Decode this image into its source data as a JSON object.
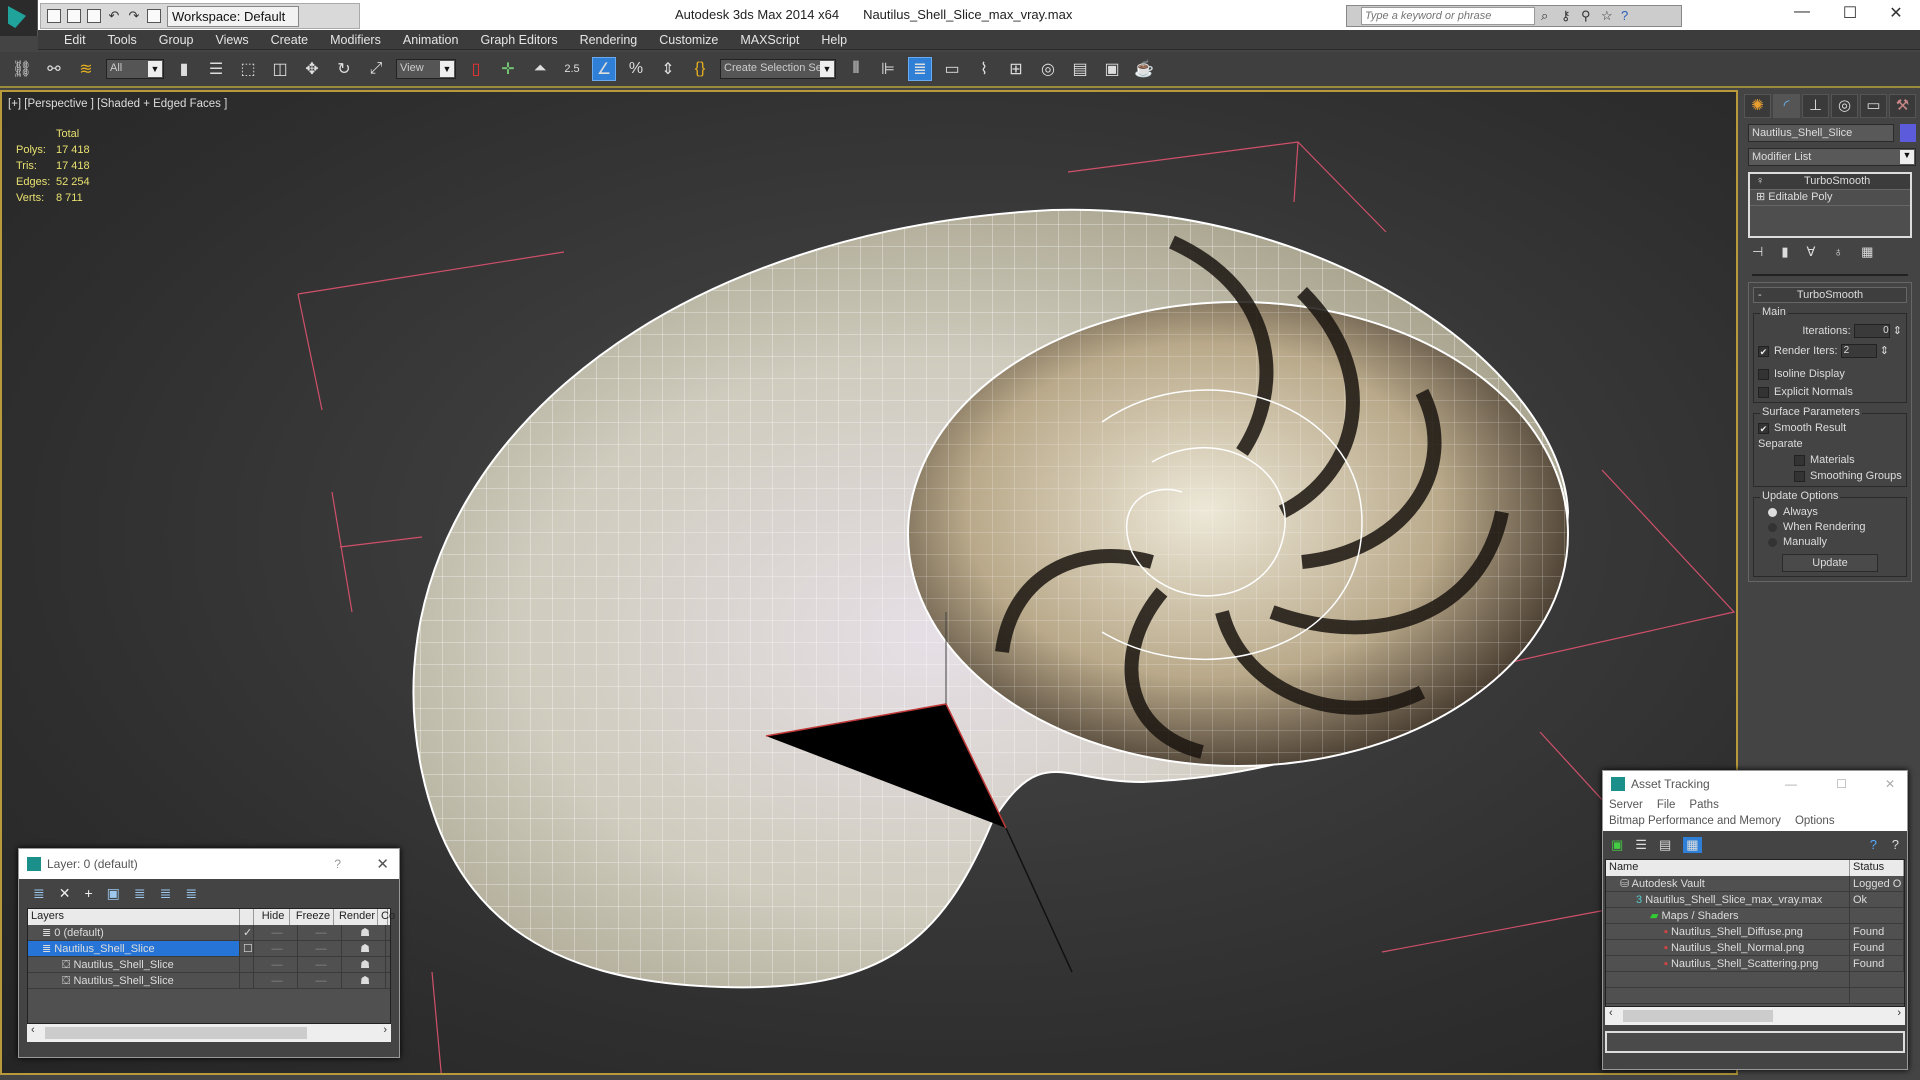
{
  "titlebar": {
    "app": "Autodesk 3ds Max 2014 x64",
    "file": "Nautilus_Shell_Slice_max_vray.max",
    "workspace": "Workspace: Default",
    "search_placeholder": "Type a keyword or phrase",
    "minimize": "—",
    "maximize": "☐",
    "close": "✕"
  },
  "menu": [
    "Edit",
    "Tools",
    "Group",
    "Views",
    "Create",
    "Modifiers",
    "Animation",
    "Graph Editors",
    "Rendering",
    "Customize",
    "MAXScript",
    "Help"
  ],
  "toolbar": {
    "selection_filter": "All",
    "coord_system": "View",
    "angle_snap_label": "2.5",
    "named_selection": "Create Selection Se"
  },
  "viewport": {
    "label": "[+] [Perspective ] [Shaded + Edged Faces ]",
    "stats": {
      "header": "Total",
      "rows": [
        {
          "k": "Polys:",
          "v": "17 418"
        },
        {
          "k": "Tris:",
          "v": "17 418"
        },
        {
          "k": "Edges:",
          "v": "52 254"
        },
        {
          "k": "Verts:",
          "v": "8 711"
        }
      ]
    }
  },
  "command_panel": {
    "object_name": "Nautilus_Shell_Slice",
    "object_color": "#5b5bdc",
    "modifier_list": "Modifier List",
    "stack": [
      "TurboSmooth",
      "Editable Poly"
    ],
    "rollout": {
      "title": "TurboSmooth",
      "main_label": "Main",
      "iterations_label": "Iterations:",
      "iterations": "0",
      "render_iters_label": "Render Iters:",
      "render_iters": "2",
      "render_iters_checked": true,
      "isoline": "Isoline Display",
      "explicit_normals": "Explicit Normals",
      "surface_label": "Surface Parameters",
      "smooth_result": "Smooth Result",
      "separate_label": "Separate",
      "materials": "Materials",
      "smoothing_groups": "Smoothing Groups",
      "update_label": "Update Options",
      "always": "Always",
      "when_rendering": "When Rendering",
      "manually": "Manually",
      "update_button": "Update"
    }
  },
  "layer_dialog": {
    "title": "Layer: 0 (default)",
    "help": "?",
    "close": "✕",
    "columns": [
      "Layers",
      "",
      "Hide",
      "Freeze",
      "Render",
      "Co"
    ],
    "rows": [
      {
        "name": "0 (default)",
        "current": "✓"
      },
      {
        "name": "Nautilus_Shell_Slice",
        "current": "☐"
      },
      {
        "name": "Nautilus_Shell_Slice",
        "current": ""
      },
      {
        "name": "Nautilus_Shell_Slice",
        "current": ""
      }
    ]
  },
  "asset_tracking": {
    "title": "Asset Tracking",
    "menu": [
      "Server",
      "File",
      "Paths"
    ],
    "menu2": [
      "Bitmap Performance and Memory",
      "Options"
    ],
    "columns": [
      "Name",
      "Status"
    ],
    "rows": [
      {
        "name": "Autodesk Vault",
        "status": "Logged O"
      },
      {
        "name": "Nautilus_Shell_Slice_max_vray.max",
        "status": "Ok"
      },
      {
        "name": "Maps / Shaders",
        "status": ""
      },
      {
        "name": "Nautilus_Shell_Diffuse.png",
        "status": "Found"
      },
      {
        "name": "Nautilus_Shell_Normal.png",
        "status": "Found"
      },
      {
        "name": "Nautilus_Shell_Scattering.png",
        "status": "Found"
      }
    ]
  }
}
